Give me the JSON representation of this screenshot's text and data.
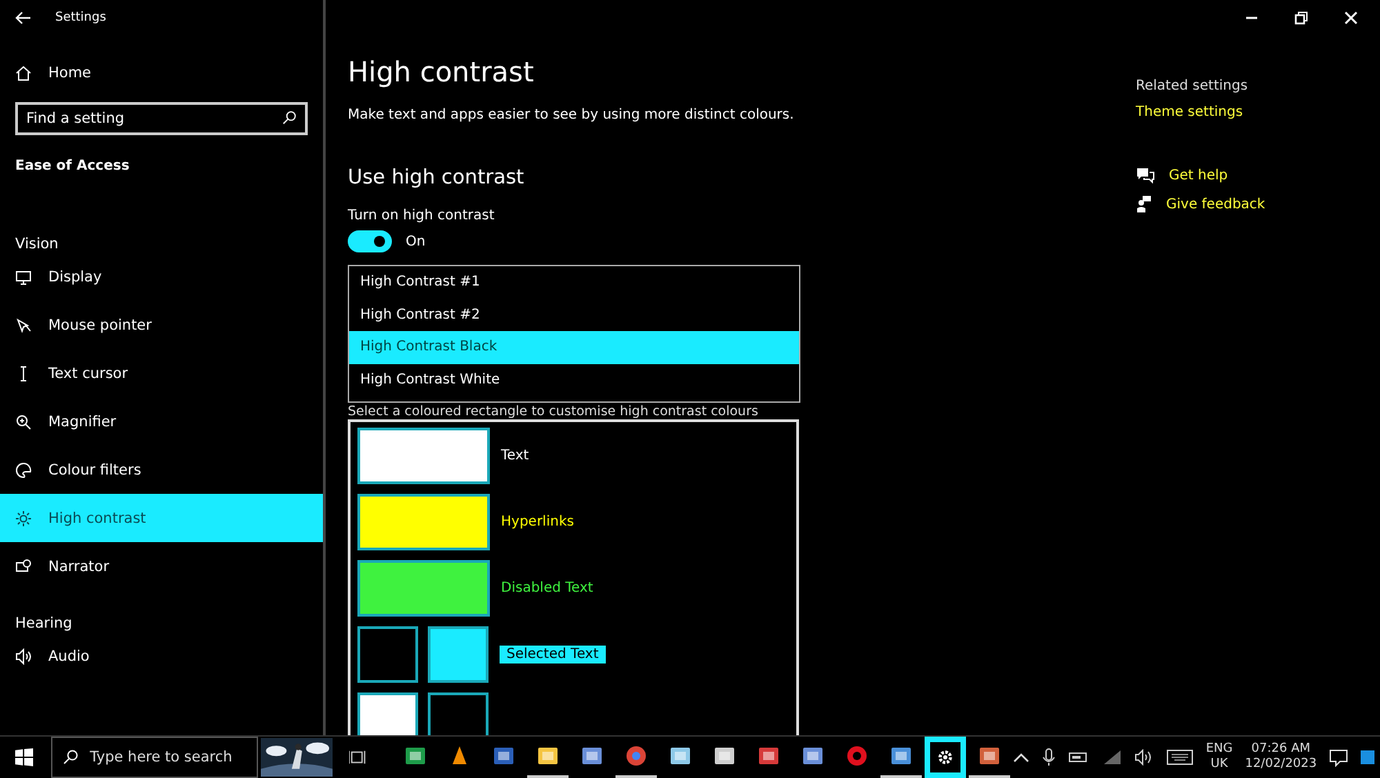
{
  "window": {
    "title": "Settings"
  },
  "sidebar": {
    "home": "Home",
    "search": {
      "placeholder": "Find a setting"
    },
    "section": "Ease of Access",
    "groups": [
      {
        "heading": "Vision",
        "items": [
          {
            "label": "Display",
            "kind": "display",
            "selected": false
          },
          {
            "label": "Mouse pointer",
            "kind": "pointer",
            "selected": false
          },
          {
            "label": "Text cursor",
            "kind": "cursor",
            "selected": false
          },
          {
            "label": "Magnifier",
            "kind": "magnifier",
            "selected": false
          },
          {
            "label": "Colour filters",
            "kind": "palette",
            "selected": false
          },
          {
            "label": "High contrast",
            "kind": "sun",
            "selected": true
          },
          {
            "label": "Narrator",
            "kind": "narrator",
            "selected": false
          }
        ]
      },
      {
        "heading": "Hearing",
        "items": [
          {
            "label": "Audio",
            "kind": "speaker",
            "selected": false
          }
        ]
      }
    ]
  },
  "main": {
    "title": "High contrast",
    "description": "Make text and apps easier to see by using more distinct colours.",
    "section": "Use high contrast",
    "toggle": {
      "label": "Turn on high contrast",
      "on": true,
      "state_text": "On"
    },
    "themes": [
      {
        "label": "High Contrast #1",
        "selected": false
      },
      {
        "label": "High Contrast #2",
        "selected": false
      },
      {
        "label": "High Contrast Black",
        "selected": true
      },
      {
        "label": "High Contrast White",
        "selected": false
      }
    ],
    "swatch_hint": "Select a coloured rectangle to customise high contrast colours",
    "swatches": [
      {
        "kind": "single",
        "samples": [
          {
            "color": "#ffffff"
          }
        ],
        "label": "Text"
      },
      {
        "kind": "single",
        "samples": [
          {
            "color": "#ffff00"
          }
        ],
        "label": "Hyperlinks"
      },
      {
        "kind": "single",
        "samples": [
          {
            "color": "#3ff23f"
          }
        ],
        "label": "Disabled Text"
      },
      {
        "kind": "pair",
        "samples": [
          {
            "color": "#000000"
          },
          {
            "color": "#1aebff"
          }
        ],
        "label": "Selected Text"
      },
      {
        "kind": "pair",
        "samples": [
          {
            "color": "#ffffff"
          },
          {
            "color": "#000000"
          }
        ]
      }
    ]
  },
  "related": {
    "heading": "Related settings",
    "links": [
      "Theme settings"
    ]
  },
  "help": [
    {
      "label": "Get help",
      "kind": "help"
    },
    {
      "label": "Give feedback",
      "kind": "feedback"
    }
  ],
  "taskbar": {
    "search_placeholder": "Type here to search",
    "apps": [
      {
        "kind": "excel",
        "running": false,
        "selected": false
      },
      {
        "kind": "vlc",
        "running": false,
        "selected": false
      },
      {
        "kind": "word",
        "running": false,
        "selected": false
      },
      {
        "kind": "folder",
        "running": true,
        "selected": false
      },
      {
        "kind": "network",
        "running": false,
        "selected": false
      },
      {
        "kind": "chrome",
        "running": true,
        "selected": false
      },
      {
        "kind": "tablet",
        "running": false,
        "selected": false
      },
      {
        "kind": "calculator",
        "running": false,
        "selected": false
      },
      {
        "kind": "pdf",
        "running": false,
        "selected": false
      },
      {
        "kind": "network",
        "running": false,
        "selected": false
      },
      {
        "kind": "opera",
        "running": false,
        "selected": false
      },
      {
        "kind": "photos",
        "running": true,
        "selected": false
      },
      {
        "kind": "settings",
        "running": true,
        "selected": true
      },
      {
        "kind": "powerpoint",
        "running": true,
        "selected": false
      }
    ],
    "language": [
      "ENG",
      "UK"
    ],
    "time": "07:26 AM",
    "date": "12/02/2023"
  }
}
